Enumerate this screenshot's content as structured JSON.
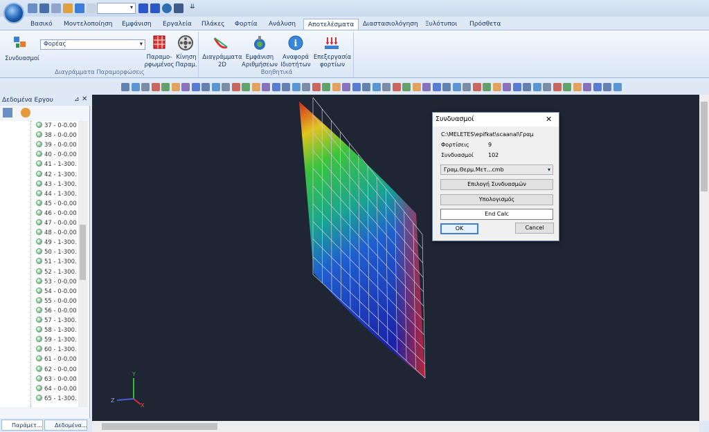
{
  "ribbon_tabs": [
    "Βασικό",
    "Μοντελοποίηση",
    "Εμφάνιση",
    "Εργαλεία",
    "Πλάκες",
    "Φορτία",
    "Ανάλυση",
    "Αποτελέσματα",
    "Διαστασιολόγηση",
    "Ξυλότυποι",
    "Πρόσθετα"
  ],
  "active_tab": "Αποτελέσματα",
  "ribbon": {
    "combinations_label": "Συνδυασμοί",
    "load_select_value": "Φορέας",
    "deformed_label_1": "Παραμο-",
    "deformed_label_2": "ρφωμένος",
    "motion_label_1": "Κίνηση",
    "motion_label_2": "Παραμ.",
    "group1_label": "Διαγράμματα Παραμορφώσεις",
    "diagrams_label_1": "Διαγράμματα",
    "diagrams_label_2": "2D",
    "numbers_label_1": "Εμφάνιση",
    "numbers_label_2": "Αριθμήσεων",
    "report_label_1": "Αναφορά",
    "report_label_2": "Ιδιοτήτων",
    "loads_label_1": "Επεξεργασία",
    "loads_label_2": "φορτίων",
    "group2_label": "Βοηθητικά"
  },
  "left_pane": {
    "title": "Δεδομένα Εργου",
    "items": [
      "37 - 0-0.00",
      "38 - 0-0.00",
      "39 - 0-0.00",
      "40 - 0-0.00",
      "41 - 1-300.",
      "42 - 1-300.",
      "43 - 1-300.",
      "44 - 1-300.",
      "45 - 0-0.00",
      "46 - 0-0.00",
      "47 - 0-0.00",
      "48 - 0-0.00",
      "49 - 1-300.",
      "50 - 1-300.",
      "51 - 1-300.",
      "52 - 1-300.",
      "53 - 0-0.00",
      "54 - 0-0.00",
      "55 - 0-0.00",
      "56 - 0-0.00",
      "57 - 1-300.",
      "58 - 1-300.",
      "59 - 1-300.",
      "60 - 1-300.",
      "61 - 0-0.00",
      "62 - 0-0.00",
      "63 - 0-0.00",
      "64 - 0-0.00",
      "65 - 1-300."
    ],
    "bottom_tab_1": "Παράμετ...",
    "bottom_tab_2": "Δεδομένα..."
  },
  "axes": {
    "x": "X",
    "y": "Y",
    "z": "Z"
  },
  "dialog": {
    "title": "Συνδυασμοί",
    "path": "C:\\MELETES\\epifkat\\scaanal\\Γραμ",
    "loads_label": "Φορτίσεις",
    "loads_value": "9",
    "combos_label": "Συνδυασμοί",
    "combos_value": "102",
    "file_select": "Γραμ.Θερμ.Μετ...cmb",
    "select_combos_button": "Επιλογή Συνδυασμών",
    "calculate_button": "Υπολογισμός",
    "status": "End Calc",
    "ok_button": "OK",
    "cancel_button": "Cancel"
  },
  "colors": {
    "viewport_bg": "#1e2634",
    "ribbon_bg": "#dfe9f5",
    "accent": "#1d5fb0"
  }
}
